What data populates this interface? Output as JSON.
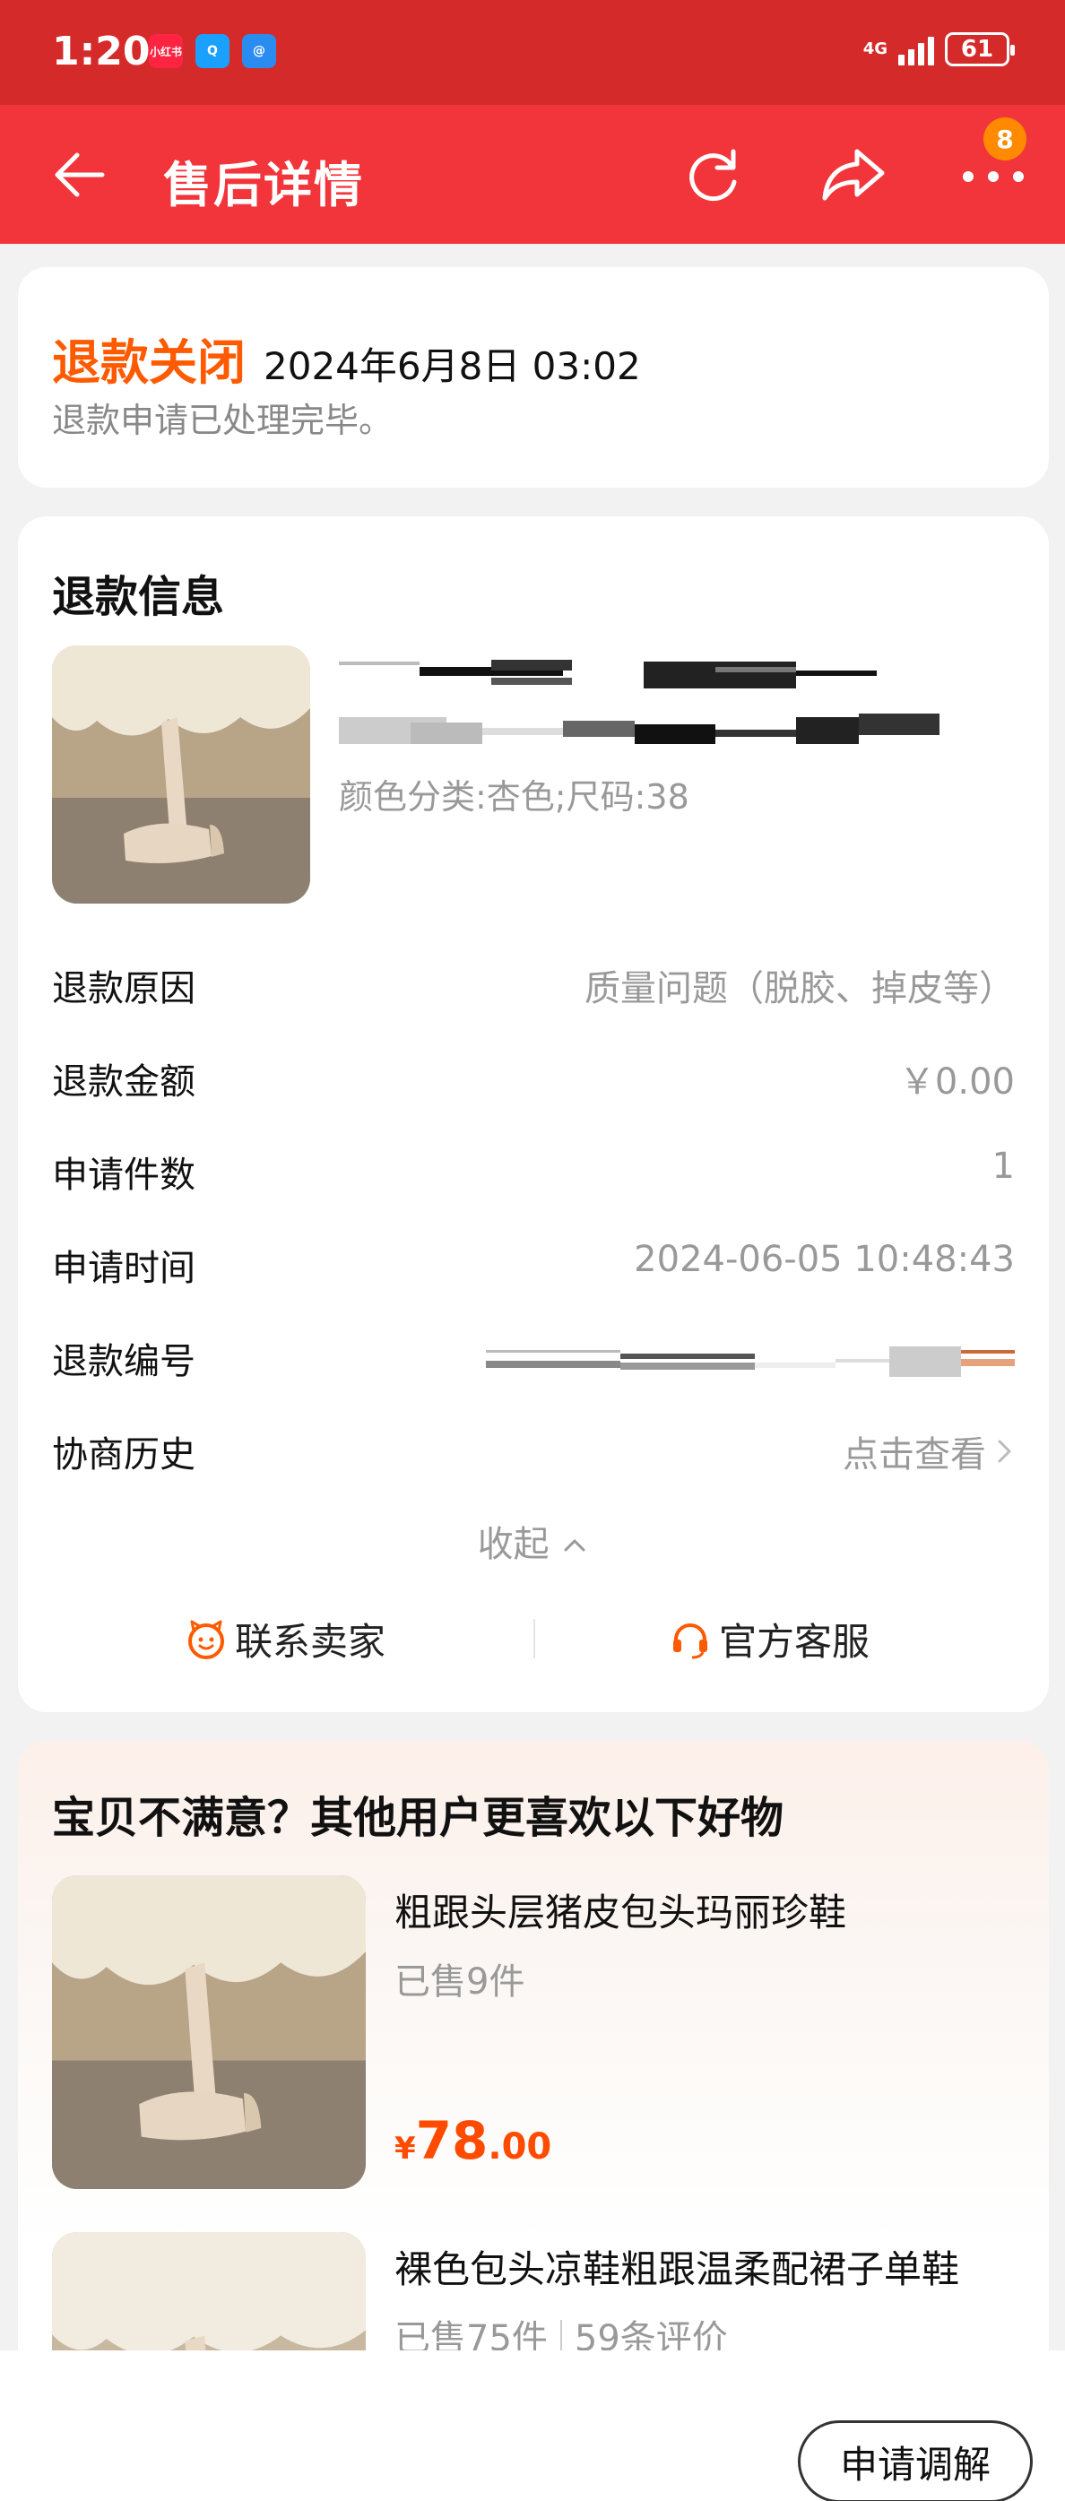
{
  "status_bar": {
    "time": "1:20",
    "apps": [
      "小红书",
      "Q",
      "@"
    ],
    "network": "4G",
    "battery": "61"
  },
  "nav": {
    "title": "售后详情",
    "notification_count": "8"
  },
  "refund_status": {
    "label": "退款关闭",
    "time": "2024年6月8日 03:02",
    "description": "退款申请已处理完毕。"
  },
  "refund_info": {
    "title": "退款信息",
    "product_spec": "颜色分类:杏色;尺码:38",
    "rows": [
      {
        "label": "退款原因",
        "value": "质量问题（脱胶、掉皮等）"
      },
      {
        "label": "退款金额",
        "value": "￥0.00"
      },
      {
        "label": "申请件数",
        "value": "1"
      },
      {
        "label": "申请时间",
        "value": "2024-06-05 10:48:43"
      },
      {
        "label": "退款编号",
        "value": ""
      },
      {
        "label": "协商历史",
        "value": "点击查看"
      }
    ],
    "collapse_label": "收起",
    "contact_seller": "联系卖家",
    "customer_service": "官方客服"
  },
  "recommendations": {
    "title": "宝贝不满意？其他用户更喜欢以下好物",
    "items": [
      {
        "name": "粗跟头层猪皮包头玛丽珍鞋",
        "sold": "已售9件",
        "reviews": "",
        "price_symbol": "¥",
        "price_int": "78",
        "price_dec": ".00"
      },
      {
        "name": "裸色包头凉鞋粗跟温柔配裙子单鞋",
        "sold": "已售75件",
        "reviews": "59条评价"
      }
    ]
  },
  "bottom": {
    "mediate_button": "申请调解"
  },
  "colors": {
    "status_bar": "#d52a2a",
    "nav_bar": "#f2353a",
    "accent_orange": "#ff5a00",
    "price": "#ff4b00"
  }
}
